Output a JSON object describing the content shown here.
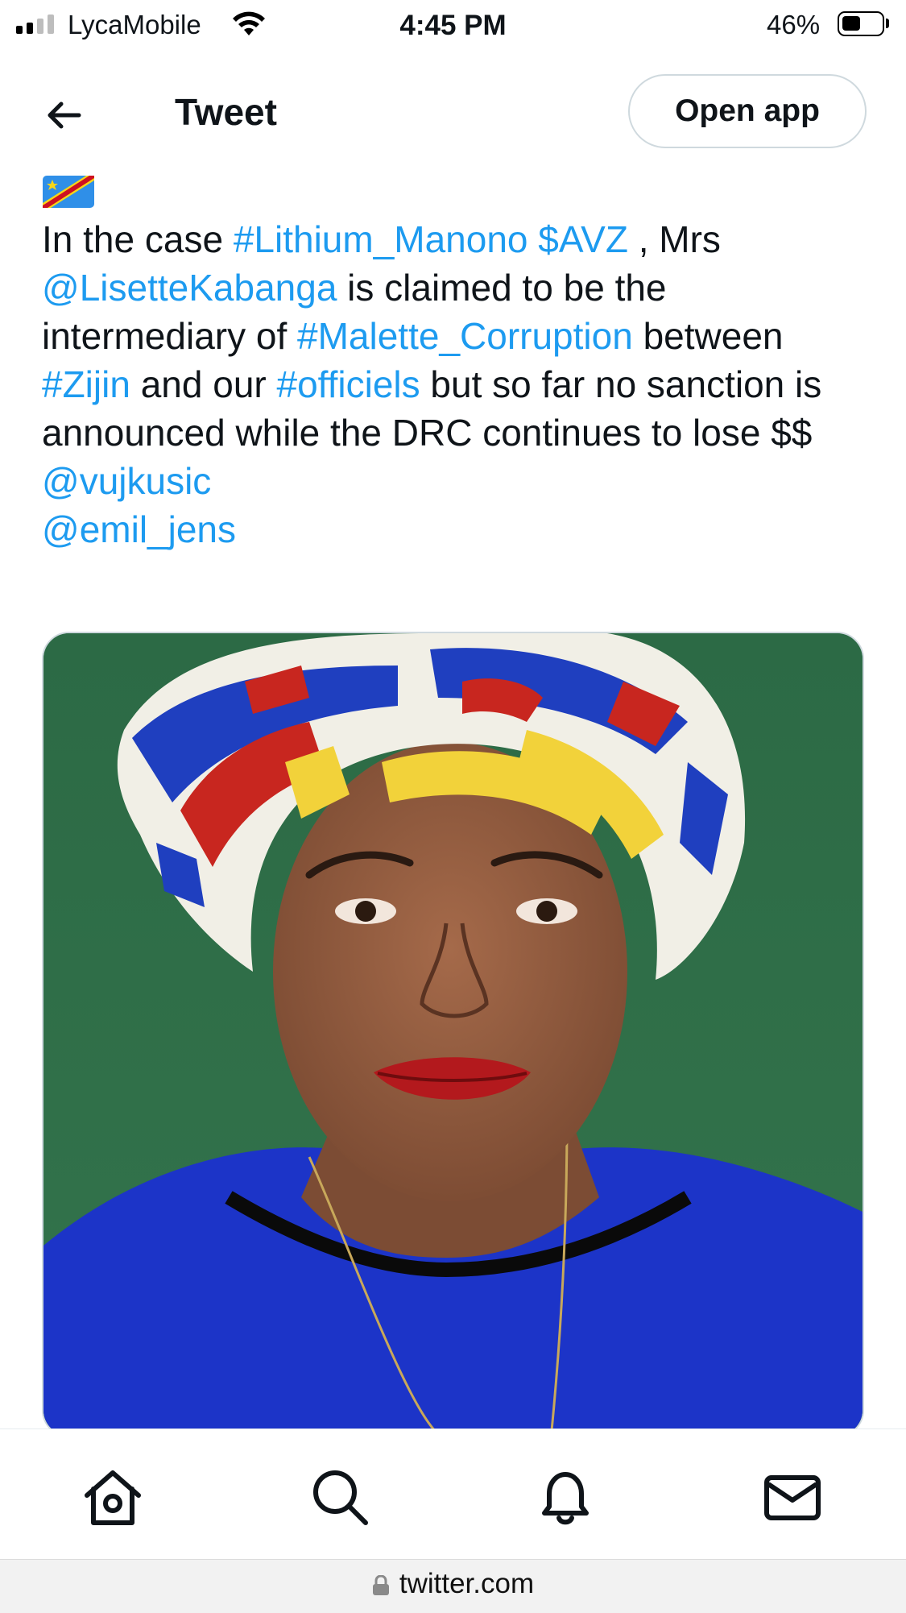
{
  "status_bar": {
    "carrier": "LycaMobile",
    "time": "4:45 PM",
    "battery_percent": "46%",
    "battery_level": 0.46,
    "signal_bars_active": 2
  },
  "header": {
    "title": "Tweet",
    "open_app_label": "Open app",
    "back_icon": "arrow-left-icon"
  },
  "tweet": {
    "flag_icon": "drc-flag",
    "segments": [
      {
        "text": "In the case ",
        "link": false
      },
      {
        "text": "#Lithium_Manono",
        "link": true
      },
      {
        "text": " ",
        "link": false
      },
      {
        "text": "$AVZ",
        "link": true
      },
      {
        "text": " , Mrs",
        "link": false
      },
      {
        "text": "\n",
        "link": false
      },
      {
        "text": "@LisetteKabanga",
        "link": true
      },
      {
        "text": " is claimed to be the intermediary of ",
        "link": false
      },
      {
        "text": "#Malette_Corruption",
        "link": true
      },
      {
        "text": " between ",
        "link": false
      },
      {
        "text": "#Zijin",
        "link": true
      },
      {
        "text": " and our ",
        "link": false
      },
      {
        "text": "#officiels",
        "link": true
      },
      {
        "text": " but so far no sanction is announced while the DRC continues to lose $$",
        "link": false
      },
      {
        "text": "\n",
        "link": false
      },
      {
        "text": "@vujkusic",
        "link": true
      },
      {
        "text": "\n",
        "link": false
      },
      {
        "text": "@emil_jens",
        "link": true
      }
    ],
    "media_description_icon": "photo"
  },
  "tab_bar": {
    "items": [
      {
        "icon": "home-icon"
      },
      {
        "icon": "search-icon"
      },
      {
        "icon": "bell-icon"
      },
      {
        "icon": "mail-icon"
      }
    ]
  },
  "url_bar": {
    "url": "twitter.com"
  },
  "colors": {
    "link": "#1d9bf0",
    "text": "#0f1419",
    "media_background": "#2f6b47",
    "headwrap_blue": "#1f3fbf",
    "headwrap_yellow": "#f2d23a",
    "headwrap_red": "#c8261f",
    "shirt_blue": "#1c34c8"
  }
}
